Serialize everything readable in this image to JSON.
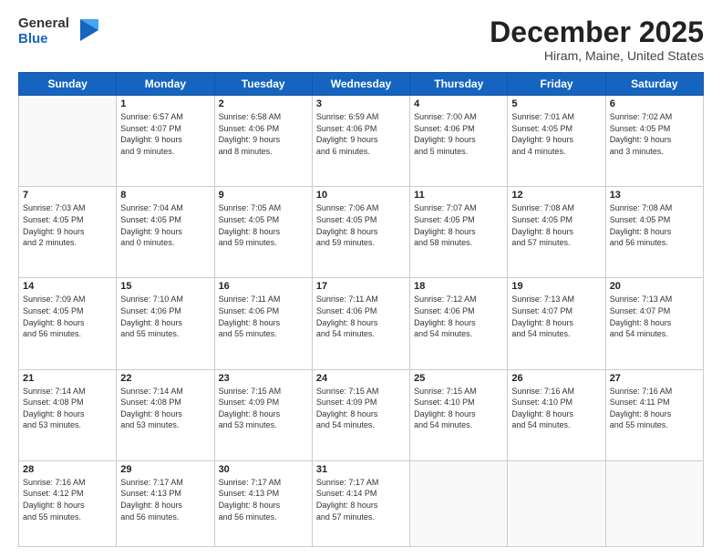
{
  "header": {
    "logo_line1": "General",
    "logo_line2": "Blue",
    "month": "December 2025",
    "location": "Hiram, Maine, United States"
  },
  "weekdays": [
    "Sunday",
    "Monday",
    "Tuesday",
    "Wednesday",
    "Thursday",
    "Friday",
    "Saturday"
  ],
  "weeks": [
    [
      {
        "day": "",
        "info": ""
      },
      {
        "day": "1",
        "info": "Sunrise: 6:57 AM\nSunset: 4:07 PM\nDaylight: 9 hours\nand 9 minutes."
      },
      {
        "day": "2",
        "info": "Sunrise: 6:58 AM\nSunset: 4:06 PM\nDaylight: 9 hours\nand 8 minutes."
      },
      {
        "day": "3",
        "info": "Sunrise: 6:59 AM\nSunset: 4:06 PM\nDaylight: 9 hours\nand 6 minutes."
      },
      {
        "day": "4",
        "info": "Sunrise: 7:00 AM\nSunset: 4:06 PM\nDaylight: 9 hours\nand 5 minutes."
      },
      {
        "day": "5",
        "info": "Sunrise: 7:01 AM\nSunset: 4:05 PM\nDaylight: 9 hours\nand 4 minutes."
      },
      {
        "day": "6",
        "info": "Sunrise: 7:02 AM\nSunset: 4:05 PM\nDaylight: 9 hours\nand 3 minutes."
      }
    ],
    [
      {
        "day": "7",
        "info": "Sunrise: 7:03 AM\nSunset: 4:05 PM\nDaylight: 9 hours\nand 2 minutes."
      },
      {
        "day": "8",
        "info": "Sunrise: 7:04 AM\nSunset: 4:05 PM\nDaylight: 9 hours\nand 0 minutes."
      },
      {
        "day": "9",
        "info": "Sunrise: 7:05 AM\nSunset: 4:05 PM\nDaylight: 8 hours\nand 59 minutes."
      },
      {
        "day": "10",
        "info": "Sunrise: 7:06 AM\nSunset: 4:05 PM\nDaylight: 8 hours\nand 59 minutes."
      },
      {
        "day": "11",
        "info": "Sunrise: 7:07 AM\nSunset: 4:05 PM\nDaylight: 8 hours\nand 58 minutes."
      },
      {
        "day": "12",
        "info": "Sunrise: 7:08 AM\nSunset: 4:05 PM\nDaylight: 8 hours\nand 57 minutes."
      },
      {
        "day": "13",
        "info": "Sunrise: 7:08 AM\nSunset: 4:05 PM\nDaylight: 8 hours\nand 56 minutes."
      }
    ],
    [
      {
        "day": "14",
        "info": "Sunrise: 7:09 AM\nSunset: 4:05 PM\nDaylight: 8 hours\nand 56 minutes."
      },
      {
        "day": "15",
        "info": "Sunrise: 7:10 AM\nSunset: 4:06 PM\nDaylight: 8 hours\nand 55 minutes."
      },
      {
        "day": "16",
        "info": "Sunrise: 7:11 AM\nSunset: 4:06 PM\nDaylight: 8 hours\nand 55 minutes."
      },
      {
        "day": "17",
        "info": "Sunrise: 7:11 AM\nSunset: 4:06 PM\nDaylight: 8 hours\nand 54 minutes."
      },
      {
        "day": "18",
        "info": "Sunrise: 7:12 AM\nSunset: 4:06 PM\nDaylight: 8 hours\nand 54 minutes."
      },
      {
        "day": "19",
        "info": "Sunrise: 7:13 AM\nSunset: 4:07 PM\nDaylight: 8 hours\nand 54 minutes."
      },
      {
        "day": "20",
        "info": "Sunrise: 7:13 AM\nSunset: 4:07 PM\nDaylight: 8 hours\nand 54 minutes."
      }
    ],
    [
      {
        "day": "21",
        "info": "Sunrise: 7:14 AM\nSunset: 4:08 PM\nDaylight: 8 hours\nand 53 minutes."
      },
      {
        "day": "22",
        "info": "Sunrise: 7:14 AM\nSunset: 4:08 PM\nDaylight: 8 hours\nand 53 minutes."
      },
      {
        "day": "23",
        "info": "Sunrise: 7:15 AM\nSunset: 4:09 PM\nDaylight: 8 hours\nand 53 minutes."
      },
      {
        "day": "24",
        "info": "Sunrise: 7:15 AM\nSunset: 4:09 PM\nDaylight: 8 hours\nand 54 minutes."
      },
      {
        "day": "25",
        "info": "Sunrise: 7:15 AM\nSunset: 4:10 PM\nDaylight: 8 hours\nand 54 minutes."
      },
      {
        "day": "26",
        "info": "Sunrise: 7:16 AM\nSunset: 4:10 PM\nDaylight: 8 hours\nand 54 minutes."
      },
      {
        "day": "27",
        "info": "Sunrise: 7:16 AM\nSunset: 4:11 PM\nDaylight: 8 hours\nand 55 minutes."
      }
    ],
    [
      {
        "day": "28",
        "info": "Sunrise: 7:16 AM\nSunset: 4:12 PM\nDaylight: 8 hours\nand 55 minutes."
      },
      {
        "day": "29",
        "info": "Sunrise: 7:17 AM\nSunset: 4:13 PM\nDaylight: 8 hours\nand 56 minutes."
      },
      {
        "day": "30",
        "info": "Sunrise: 7:17 AM\nSunset: 4:13 PM\nDaylight: 8 hours\nand 56 minutes."
      },
      {
        "day": "31",
        "info": "Sunrise: 7:17 AM\nSunset: 4:14 PM\nDaylight: 8 hours\nand 57 minutes."
      },
      {
        "day": "",
        "info": ""
      },
      {
        "day": "",
        "info": ""
      },
      {
        "day": "",
        "info": ""
      }
    ]
  ]
}
